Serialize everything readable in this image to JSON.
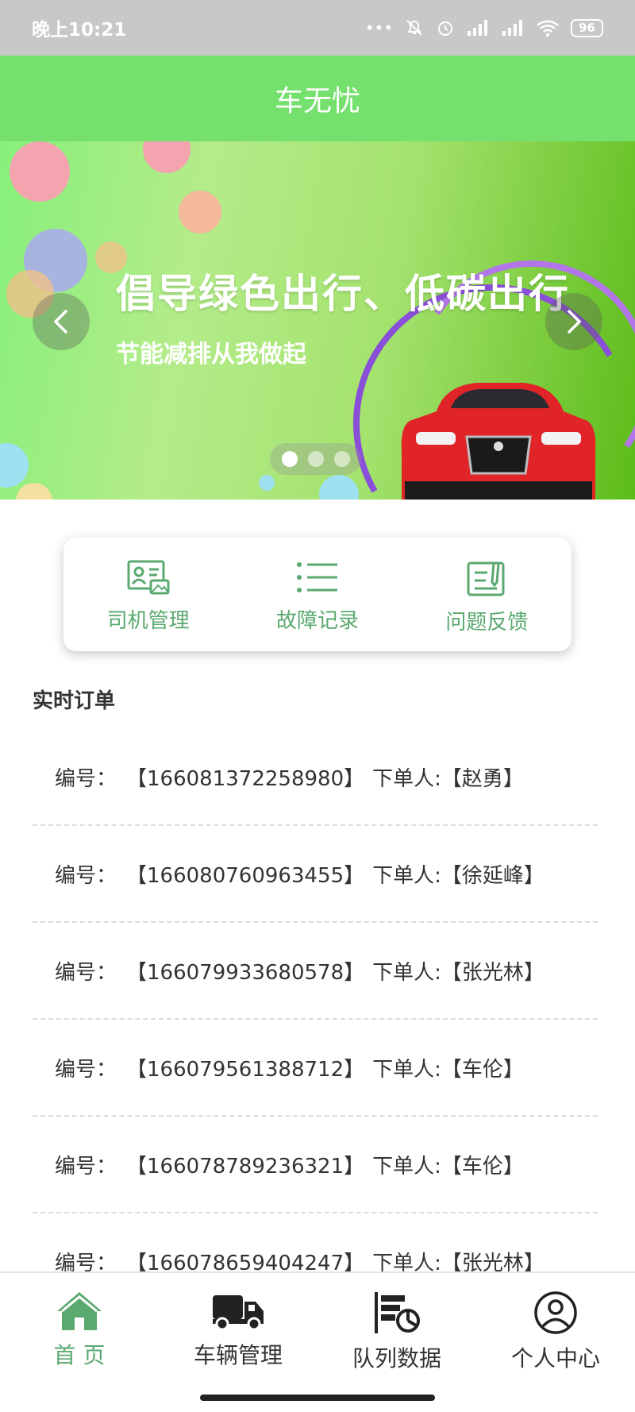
{
  "status_bar": {
    "time": "晚上10:21",
    "battery": "96"
  },
  "header": {
    "title": "车无忧"
  },
  "banner": {
    "title": "倡导绿色出行、低碳出行",
    "subtitle": "节能减排从我做起",
    "active_slide": 1,
    "slide_count": 3
  },
  "quick_menu": [
    {
      "label": "司机管理",
      "icon": "driver-card-icon"
    },
    {
      "label": "故障记录",
      "icon": "list-icon"
    },
    {
      "label": "问题反馈",
      "icon": "feedback-edit-icon"
    }
  ],
  "orders": {
    "title": "实时订单",
    "id_label": "编号：",
    "user_label": "下单人:",
    "items": [
      {
        "id": "【166081372258980】",
        "user": "【赵勇】"
      },
      {
        "id": "【166080760963455】",
        "user": "【徐延峰】"
      },
      {
        "id": "【166079933680578】",
        "user": "【张光林】"
      },
      {
        "id": "【166079561388712】",
        "user": "【车伦】"
      },
      {
        "id": "【166078789236321】",
        "user": "【车伦】"
      },
      {
        "id": "【166078659404247】",
        "user": "【张光林】"
      }
    ]
  },
  "tabbar": {
    "items": [
      {
        "label": "首 页",
        "icon": "home-icon",
        "active": true
      },
      {
        "label": "车辆管理",
        "icon": "truck-icon",
        "active": false
      },
      {
        "label": "队列数据",
        "icon": "queue-data-icon",
        "active": false
      },
      {
        "label": "个人中心",
        "icon": "user-icon",
        "active": false
      }
    ]
  },
  "colors": {
    "primary": "#76e06e",
    "accent": "#5aa96f",
    "status_bar": "#c8c8c8"
  }
}
